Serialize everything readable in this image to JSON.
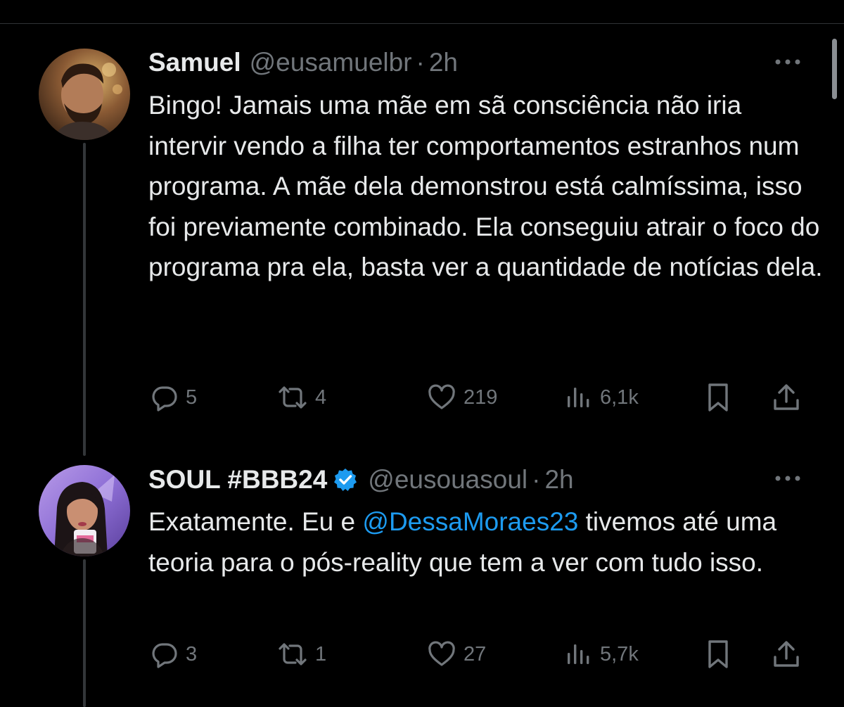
{
  "colors": {
    "background": "#000000",
    "primary_text": "#e7e9ea",
    "secondary_text": "#71767b",
    "mention": "#1d9bf0",
    "verified_badge": "#1d9bf0",
    "divider": "#2f3336"
  },
  "tweets": [
    {
      "name": "Samuel",
      "handle": "@eusamuelbr",
      "separator": "·",
      "time": "2h",
      "verified": false,
      "text": "Bingo! Jamais uma mãe em sã consciência não iria intervir vendo a filha ter comportamentos estranhos num programa. A mãe dela demonstrou está calmíssima, isso foi previamente combinado. Ela conseguiu atrair o foco do programa pra ela, basta ver a quantidade de notícias dela.",
      "replies": "5",
      "retweets": "4",
      "likes": "219",
      "views": "6,1k"
    },
    {
      "name": "SOUL #BBB24",
      "handle": "@eusouasoul",
      "separator": "·",
      "time": "2h",
      "verified": true,
      "text_before": "Exatamente. Eu e ",
      "mention": "@DessaMoraes23",
      "text_after": " tivemos até uma teoria para o pós-reality que tem a ver com tudo isso.",
      "replies": "3",
      "retweets": "1",
      "likes": "27",
      "views": "5,7k"
    }
  ],
  "icons": {
    "more": "more-options-icon",
    "reply": "reply-icon",
    "retweet": "retweet-icon",
    "like": "heart-icon",
    "views": "views-icon",
    "bookmark": "bookmark-icon",
    "share": "share-icon",
    "verified": "verified-badge-icon"
  }
}
